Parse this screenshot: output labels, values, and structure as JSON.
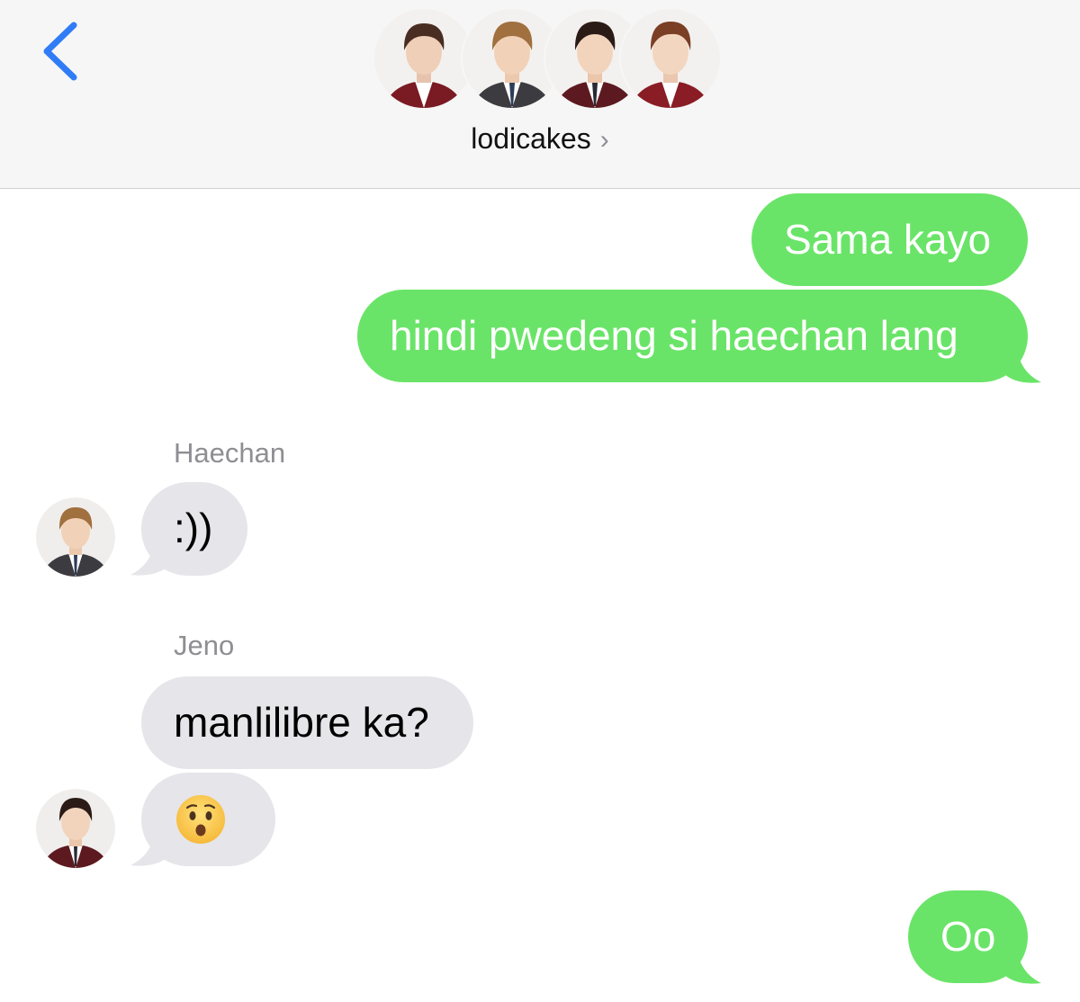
{
  "header": {
    "back_label": "Back",
    "group_name": "lodicakes",
    "chevron": "›"
  },
  "messages": [
    {
      "direction": "outgoing",
      "text": "Sama kayo"
    },
    {
      "direction": "outgoing",
      "text": "hindi pwedeng si haechan lang"
    },
    {
      "direction": "incoming",
      "sender": "Haechan",
      "text": ":))"
    },
    {
      "direction": "incoming",
      "sender": "Jeno",
      "text": "manlilibre ka?"
    },
    {
      "direction": "incoming",
      "text": "😯"
    },
    {
      "direction": "outgoing",
      "text": "Oo"
    }
  ],
  "colors": {
    "outgoing_bubble": "#6ae468",
    "incoming_bubble": "#e5e5ea",
    "accent": "#2f7cf6",
    "header_bg": "#f6f6f6",
    "sender_text": "#8e8e93"
  },
  "icons": {
    "back": "chevron-left-icon",
    "disclosure": "chevron-right-icon"
  }
}
